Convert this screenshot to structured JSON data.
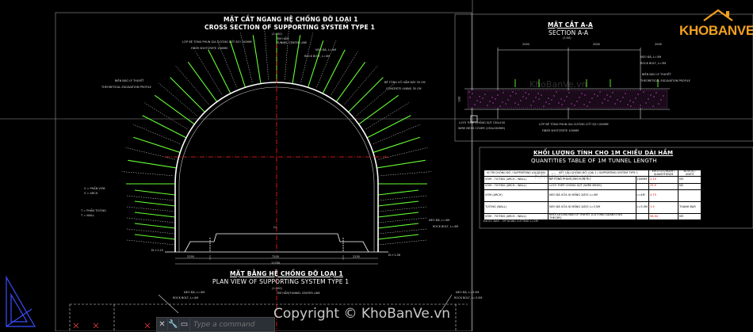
{
  "cross_section": {
    "title_vn": "MẶT CẮT NGANG HỆ CHỐNG ĐỠ LOẠI 1",
    "title_en": "CROSS SECTION OF SUPPORTING SYSTEM TYPE 1",
    "scale": "(1:100)",
    "center_line_1": "TIM HẦM",
    "center_line_2": "TUNNEL CENTER LINE",
    "label_shotcrete_vn": "LỚP BÊ TÔNG PHUN GIA CƯỜNG CỐT SỢI 100MM",
    "label_shotcrete_en": "FIBER SHOTCRETE 100MM",
    "label_rockbolt_vn": "NEO ĐÁ, L=4M",
    "label_rockbolt_en": "ROCK BOLT, L=4M",
    "label_excavation_vn": "BIÊN ĐÀO LÝ THUYẾT",
    "label_excavation_en": "THEORETICAL EXCAVATION PROFILE",
    "label_lining_vn": "BÊ TÔNG VỎ HẦM DÀY 30 CM",
    "label_lining_en": "CONCRETE LINING 30 CM",
    "label_vom_1": "V = PHẦN VÒM",
    "label_vom_2": "V = ARCH",
    "label_tuong_1": "T = PHẦN TƯỜNG",
    "label_tuong_2": "T = WALL",
    "label_rockbolt2_vn": "NEO ĐÁ, L=4M",
    "label_rockbolt2_en": "ROCK BOLT, L=4M",
    "elev_left": "EL+1.25",
    "elev_right": "EL+1.38",
    "dim_left": "2250",
    "dim_center": "7200",
    "dim_right": "2250",
    "dim_total": "11700",
    "center_mark": "CL"
  },
  "section_aa": {
    "title_vn": "MẶT CẮT A-A",
    "title_en": "SECTION A-A",
    "scale": "(1:50)",
    "dim_1": "2000",
    "dim_2": "2000",
    "dim_3": "2000",
    "label_rockbolt_vn": "NEO ĐÁ, L=3M",
    "label_rockbolt_en": "ROCK BOLT, L=3M",
    "label_excavation_vn": "BIÊN ĐÀO LÝ THUYẾT",
    "label_excavation_en": "THEORETICAL EXCAVATION PROFILE",
    "label_mesh_vn": "LƯỚI THÉP CHỐNG SỤT 150x150",
    "label_mesh_en": "WIRE MESH COVER (150x150MM)",
    "label_shotcrete_vn": "LỚP BÊ TÔNG PHUN GIA CƯỜNG CỐT SỢI 100MM",
    "label_shotcrete_en": "FIBER SHOTCRETE 100MM",
    "height_mark": "100"
  },
  "quantities": {
    "title_vn": "KHỐI LƯỢNG TÍNH CHO 1M CHIỀU DÀI HẦM",
    "title_en": "QUANTITIES TABLE OF 1M TUNNEL LENGTH",
    "headers": [
      "VỊ TRÍ CHỐNG ĐỠ / SUPPORTING LOCATION",
      "KẾT CẤU CHỐNG ĐỠ LOẠI 1 / SUPPORTING SYSTEM TYPE 1",
      "",
      "KHỐI LƯỢNG/M / QUANTITIES/M",
      "ĐƠN VỊ / UNITS"
    ],
    "rows": [
      [
        "VÒM - TƯỜNG (ARCH - WALL)",
        "BÊ TÔNG PHUN (SHOTCRETE)",
        "100MM",
        "2.19",
        "M3"
      ],
      [
        "VÒM - TƯỜNG (ARCH - WALL)",
        "LƯỚI THÉP CHỐNG SỤT (WIRE MESH)",
        "",
        "25.9",
        "M2"
      ],
      [
        "VÒM (ARCH)",
        "NEO ĐÁ VỮA XI MĂNG 2Ø25 L=4M",
        "L=4M",
        "4.75",
        ""
      ],
      [
        "TƯỜNG (WALL)",
        "NEO ĐÁ VỮA XI MĂNG 2Ø25 L=3.5M",
        "L=3.5M",
        "1.5",
        "THANH BAR"
      ],
      [
        "VÒM - TƯỜNG (ARCH - WALL)",
        "KHỐI LƯỢNG ĐÀO LÝ THUYẾT (CUTTING QUANTITIES THEORY)",
        "",
        "58.54",
        "M3"
      ]
    ],
    "footnote": "ĐƯỢC ĐÀO - OP ACING CUTTING L=2M"
  },
  "plan_view": {
    "title_vn": "MẶT BẰNG HỆ CHỐNG ĐỠ LOẠI 1",
    "title_en": "PLAN VIEW OF SUPPORTING SYSTEM TYPE 1",
    "scale": "(1:100)",
    "center_line": "TIM HẦM/TUNNEL CENTER LINE",
    "label_left_vn": "NEO ĐÁ, L=4M",
    "label_left_en": "ROCK BOLT, L=4M",
    "label_right_vn": "NEO ĐÁ, L=3.5M",
    "label_right_en": "ROCK BOLT, L=3.5M"
  },
  "command_bar": {
    "placeholder": "Type a command",
    "close_glyph": "✕",
    "wrench_glyph": "🔧",
    "cmd_glyph": "▭"
  },
  "branding": {
    "logo_text": "KHOBANVE",
    "watermark": "KhoBanVe.vn",
    "copyright": "Copyright © KhoBanVe.vn",
    "accent": "#f0a020"
  },
  "colors": {
    "background": "#000000",
    "bolts": "#66ff33",
    "centerline": "#ff2020",
    "rock_shading": "#ff66ff"
  }
}
